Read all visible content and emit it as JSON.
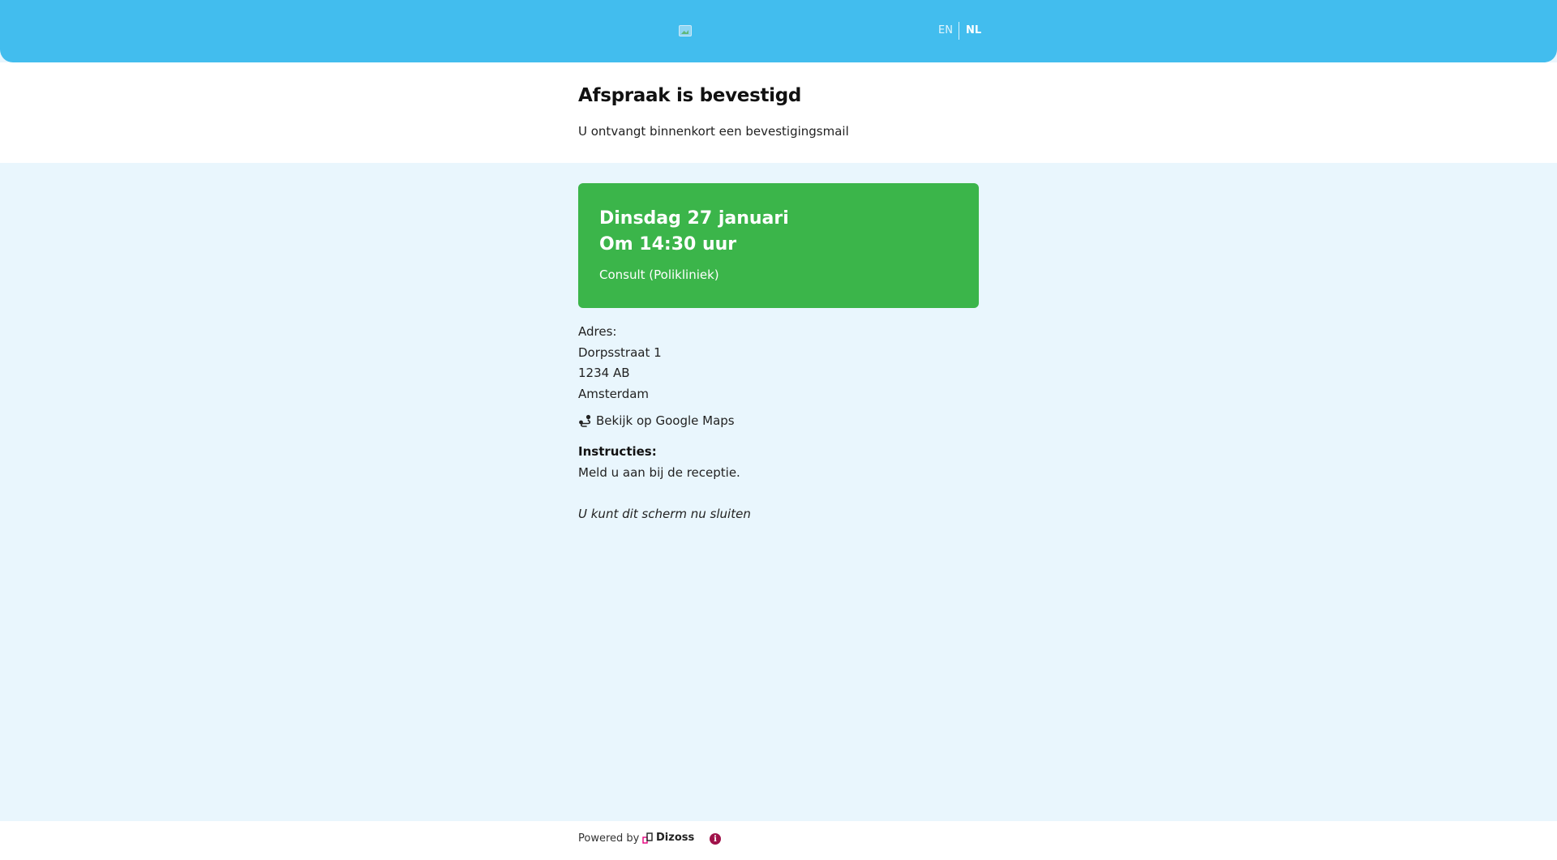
{
  "header": {
    "lang_en": "EN",
    "lang_nl": "NL",
    "logo_icon": "broken-image-icon"
  },
  "confirmation": {
    "title": "Afspraak is bevestigd",
    "subtitle": "U ontvangt binnenkort een bevestigingsmail"
  },
  "appointment": {
    "date": "Dinsdag 27 januari",
    "time": "Om 14:30 uur",
    "type": "Consult (Polikliniek)"
  },
  "address": {
    "label": "Adres:",
    "street": "Dorpsstraat 1",
    "postcode": "1234 AB",
    "city": "Amsterdam",
    "maps_link": "Bekijk op Google Maps",
    "maps_icon": "route-icon"
  },
  "instructions": {
    "label": "Instructies:",
    "text": "Meld u aan bij de receptie."
  },
  "close_note": "U kunt dit scherm nu sluiten",
  "footer": {
    "powered_by": "Powered by",
    "brand": "Dizoss",
    "info_icon": "info-icon"
  },
  "colors": {
    "header_bg": "#42bdee",
    "page_bg": "#e9f6fd",
    "card_bg": "#3bb54a",
    "info_icon": "#a0124a",
    "brand_accent": "#e6007e"
  }
}
